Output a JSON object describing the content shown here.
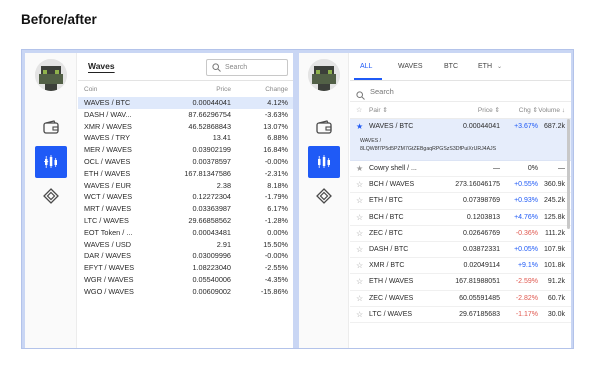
{
  "page_title": "Before/after",
  "before": {
    "asset": "Waves",
    "search_placeholder": "Search",
    "columns": {
      "coin": "Coin",
      "price": "Price",
      "change": "Change"
    },
    "rows": [
      {
        "coin": "WAVES / BTC",
        "price": "0.00044041",
        "change": "4.12%"
      },
      {
        "coin": "DASH / WAV...",
        "price": "87.66296754",
        "change": "-3.63%"
      },
      {
        "coin": "XMR / WAVES",
        "price": "46.52868843",
        "change": "13.07%"
      },
      {
        "coin": "WAVES / TRY",
        "price": "13.41",
        "change": "6.88%"
      },
      {
        "coin": "MER / WAVES",
        "price": "0.03902199",
        "change": "16.84%"
      },
      {
        "coin": "OCL / WAVES",
        "price": "0.00378597",
        "change": "-0.00%"
      },
      {
        "coin": "ETH / WAVES",
        "price": "167.81347586",
        "change": "-2.31%"
      },
      {
        "coin": "WAVES / EUR",
        "price": "2.38",
        "change": "8.18%"
      },
      {
        "coin": "WCT / WAVES",
        "price": "0.12272304",
        "change": "-1.79%"
      },
      {
        "coin": "MRT / WAVES",
        "price": "0.03363987",
        "change": "6.17%"
      },
      {
        "coin": "LTC / WAVES",
        "price": "29.66858562",
        "change": "-1.28%"
      },
      {
        "coin": "EOT Token / ...",
        "price": "0.00043481",
        "change": "0.00%"
      },
      {
        "coin": "WAVES / USD",
        "price": "2.91",
        "change": "15.50%"
      },
      {
        "coin": "DAR / WAVES",
        "price": "0.03009996",
        "change": "-0.00%"
      },
      {
        "coin": "EFYT / WAVES",
        "price": "1.08223040",
        "change": "-2.55%"
      },
      {
        "coin": "WGR / WAVES",
        "price": "0.05540006",
        "change": "-4.35%"
      },
      {
        "coin": "WGO / WAVES",
        "price": "0.00609002",
        "change": "-15.86%"
      }
    ]
  },
  "after": {
    "tabs": [
      "ALL",
      "WAVES",
      "BTC",
      "ETH"
    ],
    "eth_chevron": "⌄",
    "search_placeholder": "Search",
    "columns": {
      "pair": "Pair",
      "price": "Price",
      "change": "Chg",
      "volume": "Volume"
    },
    "selected_detail": {
      "label": "WAVES /",
      "address": "8LQW8f7P5d5PZM7GtZEBgaqRPGSzS3DfPuiXrURJ4AJS"
    },
    "rows": [
      {
        "pair": "WAVES / BTC",
        "price": "0.00044041",
        "change": "+3.67%",
        "dir": "pos",
        "volume": "687.2k",
        "starred": true
      },
      {
        "pair": "Cowry shell / ...",
        "price": "—",
        "change": "0%",
        "dir": "",
        "volume": "—",
        "starred": true
      },
      {
        "pair": "BCH / WAVES",
        "price": "273.16046175",
        "change": "+0.55%",
        "dir": "pos",
        "volume": "360.9k",
        "starred": false
      },
      {
        "pair": "ETH / BTC",
        "price": "0.07398769",
        "change": "+0.93%",
        "dir": "pos",
        "volume": "245.2k",
        "starred": false
      },
      {
        "pair": "BCH / BTC",
        "price": "0.1203813",
        "change": "+4.76%",
        "dir": "pos",
        "volume": "125.8k",
        "starred": false
      },
      {
        "pair": "ZEC / BTC",
        "price": "0.02646769",
        "change": "-0.36%",
        "dir": "neg",
        "volume": "111.2k",
        "starred": false
      },
      {
        "pair": "DASH / BTC",
        "price": "0.03872331",
        "change": "+0.05%",
        "dir": "pos",
        "volume": "107.9k",
        "starred": false
      },
      {
        "pair": "XMR / BTC",
        "price": "0.02049114",
        "change": "+9.1%",
        "dir": "pos",
        "volume": "101.8k",
        "starred": false
      },
      {
        "pair": "ETH / WAVES",
        "price": "167.81988051",
        "change": "-2.59%",
        "dir": "neg",
        "volume": "91.2k",
        "starred": false
      },
      {
        "pair": "ZEC / WAVES",
        "price": "60.05591485",
        "change": "-2.82%",
        "dir": "neg",
        "volume": "60.7k",
        "starred": false
      },
      {
        "pair": "LTC / WAVES",
        "price": "29.67185683",
        "change": "-1.17%",
        "dir": "neg",
        "volume": "30.0k",
        "starred": false
      }
    ]
  },
  "colors": {
    "accent": "#1f5af6",
    "negative": "#e0584f",
    "selected_row": "#dfe9fb",
    "frame": "#c9d6f4"
  }
}
